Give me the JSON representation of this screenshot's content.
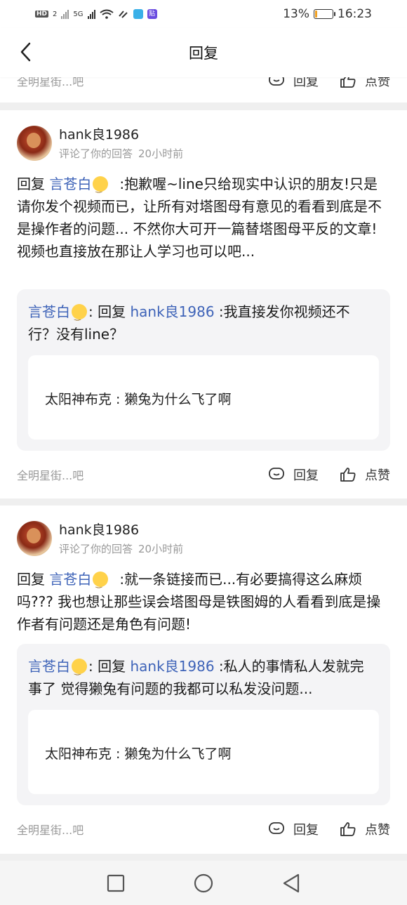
{
  "status_bar": {
    "signal_badges": [
      "HD",
      "2",
      "5G"
    ],
    "battery": "13%",
    "battery_level": 0.13,
    "time": "16:23",
    "app_icons": [
      "book-app-icon",
      "tieba-app-icon"
    ],
    "tieba_label": "贴"
  },
  "header": {
    "title": "回复"
  },
  "peek": {
    "forum": "全明星街...吧",
    "reply_label": "回复",
    "like_label": "点赞"
  },
  "items": [
    {
      "username": "hank良1986",
      "action": "评论了你的回答",
      "time": "20小时前",
      "prefix": "回复",
      "mention": "言苍白",
      "text": ":抱歉喔~line只给现实中认识的朋友!只是请你发个视频而已，让所有对塔图母有意见的看看到底是不是操作者的问题... 不然你大可开一篇替塔图母平反的文章!视频也直接放在那让人学习也可以吧...",
      "quote": {
        "author": "言苍白",
        "sep": ": 回复",
        "target": "hank良1986",
        "text": ":我直接发你视频还不行？没有line？",
        "inner": "太阳神布克 : 獭兔为什么飞了啊"
      },
      "forum": "全明星街...吧",
      "reply_label": "回复",
      "like_label": "点赞"
    },
    {
      "username": "hank良1986",
      "action": "评论了你的回答",
      "time": "20小时前",
      "prefix": "回复",
      "mention": "言苍白",
      "text": ":就一条链接而已...有必要搞得这么麻烦吗??? 我也想让那些误会塔图母是铁图姆的人看看到底是操作者有问题还是角色有问题!",
      "quote": {
        "author": "言苍白",
        "sep": ": 回复",
        "target": "hank良1986",
        "text": ":私人的事情私人发就完事了 觉得獭兔有问题的我都可以私发没问题...",
        "inner": "太阳神布克 : 獭兔为什么飞了啊"
      },
      "forum": "全明星街...吧",
      "reply_label": "回复",
      "like_label": "点赞"
    }
  ],
  "colors": {
    "mention": "#3e63b8",
    "meta": "#999999",
    "quote_bg": "#f4f4f6",
    "battery": "#f0a020"
  }
}
